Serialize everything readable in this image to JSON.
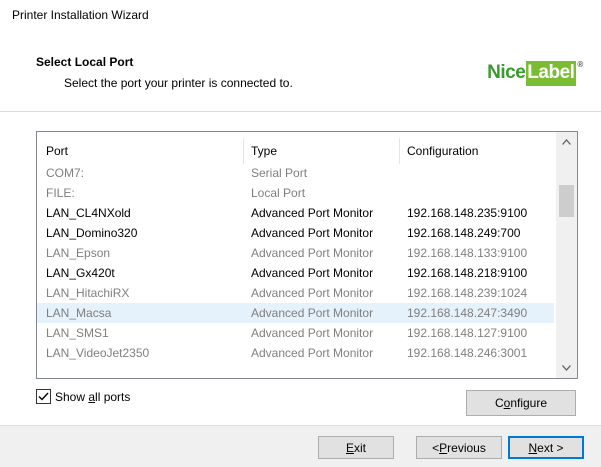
{
  "window": {
    "title": "Printer Installation Wizard"
  },
  "header": {
    "title": "Select Local Port",
    "subtitle": "Select the port your printer is connected to.",
    "logo": {
      "part1": "Nice",
      "part2": "Label",
      "reg": "®"
    }
  },
  "list": {
    "columns": [
      "Port",
      "Type",
      "Configuration"
    ],
    "rows": [
      {
        "port": "COM7:",
        "type": "Serial Port",
        "config": "",
        "enabled": false
      },
      {
        "port": "FILE:",
        "type": "Local Port",
        "config": "",
        "enabled": false
      },
      {
        "port": "LAN_CL4NXold",
        "type": "Advanced Port Monitor",
        "config": "192.168.148.235:9100",
        "enabled": true
      },
      {
        "port": "LAN_Domino320",
        "type": "Advanced Port Monitor",
        "config": "192.168.148.249:700",
        "enabled": true
      },
      {
        "port": "LAN_Epson",
        "type": "Advanced Port Monitor",
        "config": "192.168.148.133:9100",
        "enabled": false
      },
      {
        "port": "LAN_Gx420t",
        "type": "Advanced Port Monitor",
        "config": "192.168.148.218:9100",
        "enabled": true
      },
      {
        "port": "LAN_HitachiRX",
        "type": "Advanced Port Monitor",
        "config": "192.168.148.239:1024",
        "enabled": false
      },
      {
        "port": "LAN_Macsa",
        "type": "Advanced Port Monitor",
        "config": "192.168.148.247:3490",
        "enabled": false,
        "selected": true
      },
      {
        "port": "LAN_SMS1",
        "type": "Advanced Port Monitor",
        "config": "192.168.148.127:9100",
        "enabled": false
      },
      {
        "port": "LAN_VideoJet2350",
        "type": "Advanced Port Monitor",
        "config": "192.168.148.246:3001",
        "enabled": false
      }
    ]
  },
  "show_all": {
    "label_pre": "Show ",
    "label_u": "a",
    "label_post": "ll ports",
    "checked": true
  },
  "buttons": {
    "configure": {
      "pre": "C",
      "u": "o",
      "post": "nfigure"
    },
    "exit": {
      "pre": "",
      "u": "E",
      "post": "xit"
    },
    "previous": {
      "pre": "< ",
      "u": "P",
      "post": "revious"
    },
    "next": {
      "pre": "",
      "u": "N",
      "post": "ext >"
    }
  },
  "colors": {
    "accent": "#0078d7",
    "selected_row": "#e5f1fb",
    "dim_text": "#7f7f7f"
  }
}
